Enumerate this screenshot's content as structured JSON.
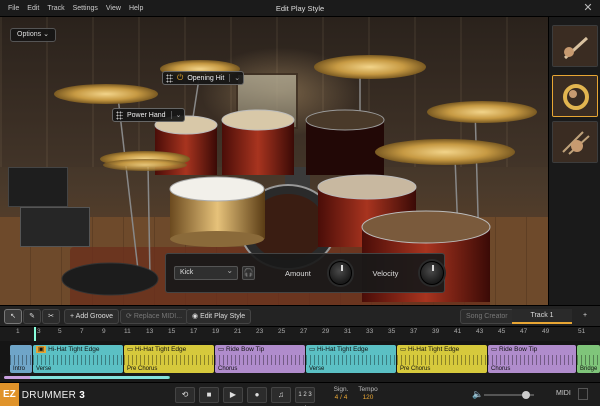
{
  "window": {
    "title": "Edit Play Style"
  },
  "menu": [
    "File",
    "Edit",
    "Track",
    "Settings",
    "View",
    "Help"
  ],
  "stage": {
    "options_label": "Options",
    "tags": {
      "opening_hit": "Opening Hit",
      "power_hand": "Power Hand"
    }
  },
  "controls": {
    "instrument": "Kick",
    "amount_label": "Amount",
    "velocity_label": "Velocity"
  },
  "toolbar": {
    "add_groove": "Add Groove",
    "replace_midi": "Replace MIDI...",
    "edit_play_style": "Edit Play Style",
    "song_creator": "Song Creator",
    "track_tab": "Track 1"
  },
  "ruler": [
    "1",
    "3",
    "5",
    "7",
    "9",
    "11",
    "13",
    "15",
    "17",
    "19",
    "21",
    "23",
    "25",
    "27",
    "29",
    "31",
    "33",
    "35",
    "37",
    "39",
    "41",
    "43",
    "45",
    "47",
    "49",
    "51"
  ],
  "clips": [
    {
      "title": "",
      "section": "Intro",
      "color": "intro"
    },
    {
      "title": "Hi-Hat Tight Edge",
      "section": "Verse",
      "color": "teal"
    },
    {
      "title": "Hi-Hat Tight Edge",
      "section": "Pre Chorus",
      "color": "yellow"
    },
    {
      "title": "Ride Bow Tip",
      "section": "Chorus",
      "color": "purple"
    },
    {
      "title": "Hi-Hat Tight Edge",
      "section": "Verse",
      "color": "teal"
    },
    {
      "title": "Hi-Hat Tight Edge",
      "section": "Pre Chorus",
      "color": "yellow"
    },
    {
      "title": "Ride Bow Tip",
      "section": "Chorus",
      "color": "purple"
    },
    {
      "title": "",
      "section": "Bridge",
      "color": "green"
    }
  ],
  "transport": {
    "logo_ez": "EZ",
    "logo_name": "DRUMMER",
    "logo_version": "3",
    "sign_label": "Sign.",
    "sign_value": "4 / 4",
    "tempo_label": "Tempo",
    "tempo_value": "120",
    "count_in": "1 2 3 4",
    "midi_label": "MIDI",
    "midi_sub": "In  Out"
  },
  "accent": "#e8a634"
}
